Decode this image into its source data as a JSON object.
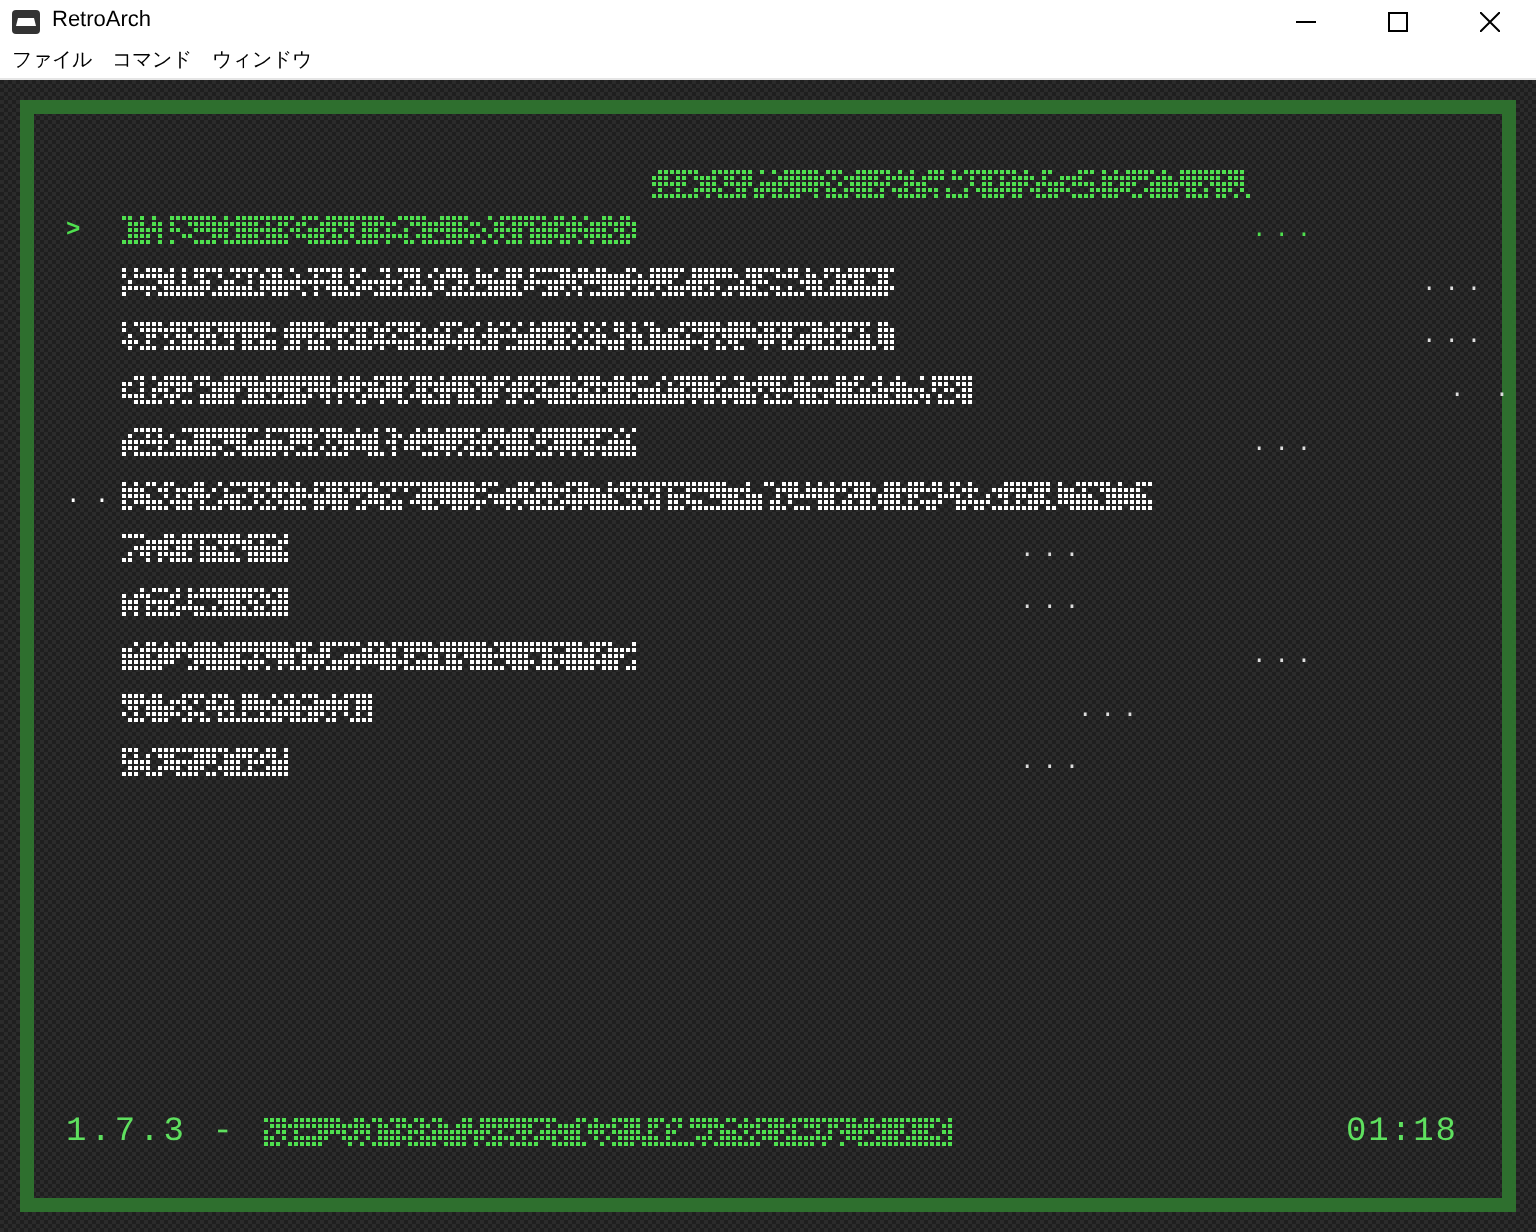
{
  "window": {
    "title": "RetroArch"
  },
  "menu": [
    {
      "label": "ファイル"
    },
    {
      "label": "コマンド"
    },
    {
      "label": "ウィンドウ"
    }
  ],
  "screen": {
    "cursor": ">",
    "rows": [
      {
        "selected": true,
        "value": "..."
      },
      {
        "selected": false,
        "value": "..."
      },
      {
        "selected": false,
        "value": "..."
      },
      {
        "selected": false,
        "value": ". ."
      },
      {
        "selected": false,
        "value": "..."
      },
      {
        "selected": false,
        "lead": ". ."
      },
      {
        "selected": false,
        "value": "..."
      },
      {
        "selected": false,
        "value": "..."
      },
      {
        "selected": false,
        "value": "..."
      },
      {
        "selected": false,
        "value": "..."
      },
      {
        "selected": false,
        "value": "..."
      }
    ],
    "footer": {
      "version": "1.7.3 -",
      "clock": "01:18"
    }
  }
}
